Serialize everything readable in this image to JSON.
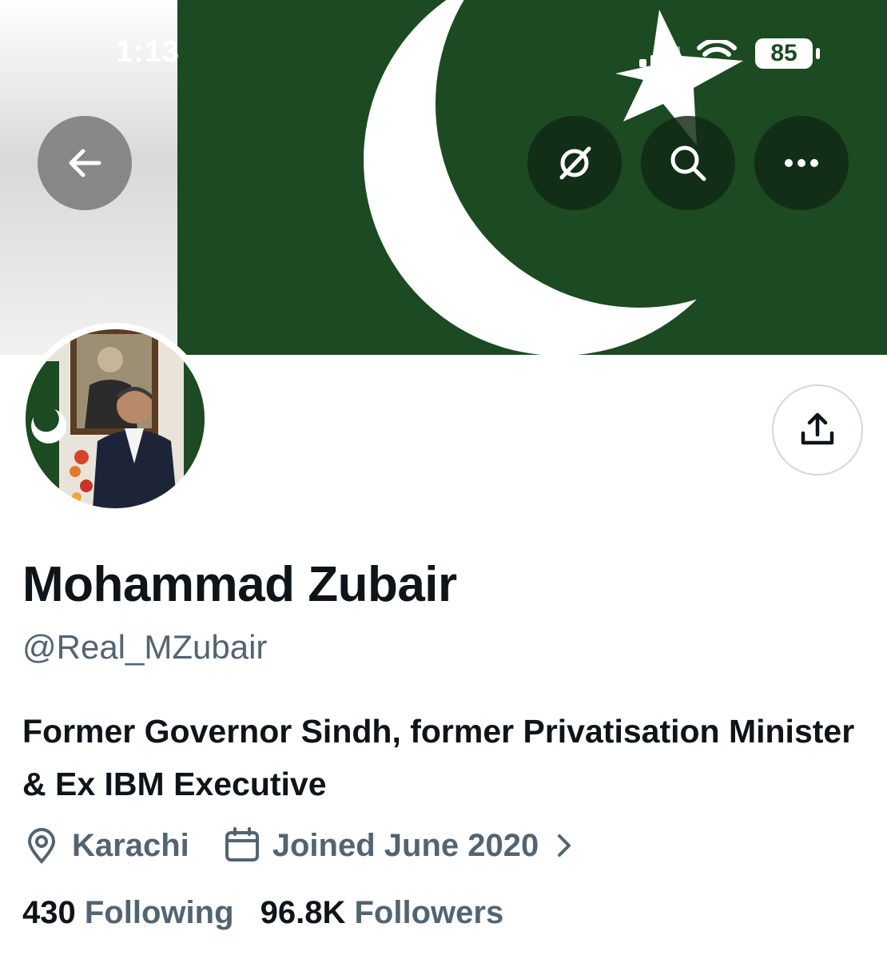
{
  "status_bar": {
    "time": "1:13",
    "battery": "85",
    "icons": [
      "cellular-signal-icon",
      "wifi-icon",
      "battery-icon"
    ]
  },
  "banner": {
    "description": "Pakistan flag",
    "colors": {
      "green": "#1c4a22",
      "white": "#ffffff"
    }
  },
  "header_buttons": [
    "back-arrow-icon",
    "grok-icon",
    "search-icon",
    "more-icon"
  ],
  "profile": {
    "name": "Mohammad Zubair",
    "handle": "@Real_MZubair",
    "bio": "Former Governor Sindh, former Privatisation Minister & Ex IBM Executive",
    "location": "Karachi",
    "joined": "Joined June 2020",
    "following_count": "430",
    "following_label": "Following",
    "followers_count": "96.8K",
    "followers_label": "Followers"
  },
  "colors": {
    "text_primary": "#0f1419",
    "text_secondary": "#536471"
  }
}
